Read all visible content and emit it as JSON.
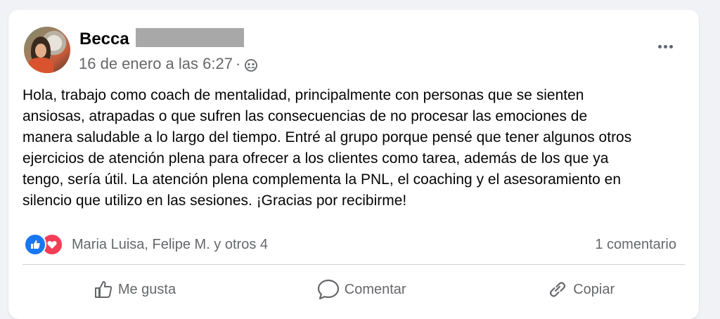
{
  "post": {
    "author_first_name": "Becca",
    "timestamp": "16 de enero a las 6:27",
    "separator": "·",
    "audience_icon": "group-icon",
    "more_icon": "more-options-icon",
    "body": "Hola, trabajo como coach de mentalidad, principalmente con personas que se sienten\nansiosas, atrapadas o que sufren las consecuencias de no procesar las emociones de\nmanera saludable a lo largo del tiempo. Entré al grupo porque pensé que tener algunos otros\nejercicios de atención plena para ofrecer a los clientes como tarea, además de los que ya\ntengo, sería útil. La atención plena complementa la PNL, el coaching y el asesoramiento en\nsilencio que utilizo en las sesiones. ¡Gracias por recibirme!"
  },
  "reactions": {
    "types": [
      "like",
      "love"
    ],
    "summary": "Maria Luisa, Felipe M. y otros 4",
    "comments": "1 comentario"
  },
  "actions": {
    "like_label": "Me gusta",
    "comment_label": "Comentar",
    "copy_label": "Copiar"
  },
  "colors": {
    "like_blue": "#1877f2",
    "love_red": "#f33e58",
    "secondary_text": "#65676b",
    "redaction_gray": "#a8a8a8"
  }
}
